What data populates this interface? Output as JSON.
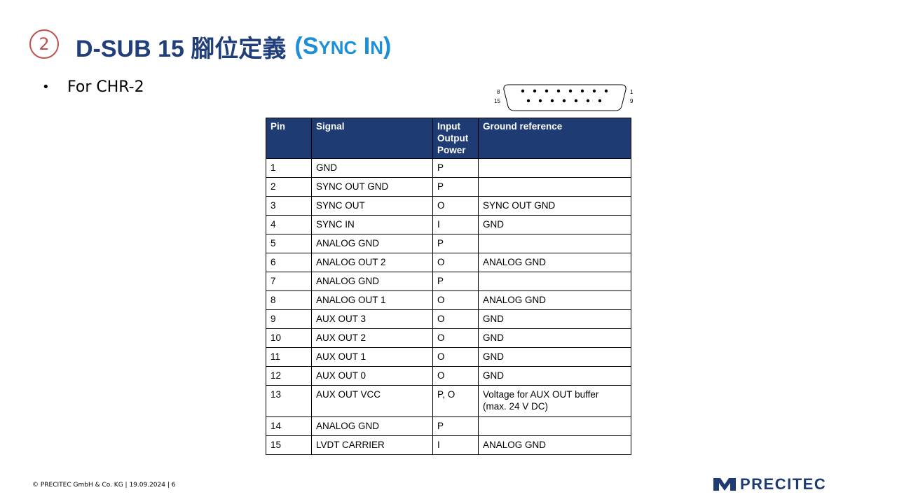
{
  "title": {
    "number": "2",
    "main": "D-SUB 15 腳位定義",
    "accent_open": "(",
    "accent_s": "S",
    "accent_ync": "YNC",
    "accent_i": "I",
    "accent_n": "N",
    "accent_close": ")"
  },
  "bullet": {
    "symbol": "•",
    "text": "For CHR-2"
  },
  "connector": {
    "label_8": "8",
    "label_15": "15",
    "label_1": "1",
    "label_9": "9"
  },
  "table": {
    "headers": {
      "pin": "Pin",
      "signal": "Signal",
      "io_line1": "Input",
      "io_line2": "Output",
      "io_line3": "Power",
      "ground": "Ground reference"
    },
    "rows": [
      {
        "pin": "1",
        "signal": "GND",
        "io": "P",
        "ground": ""
      },
      {
        "pin": "2",
        "signal": "SYNC OUT GND",
        "io": "P",
        "ground": ""
      },
      {
        "pin": "3",
        "signal": "SYNC OUT",
        "io": "O",
        "ground": "SYNC OUT GND"
      },
      {
        "pin": "4",
        "signal": "SYNC IN",
        "io": "I",
        "ground": "GND"
      },
      {
        "pin": "5",
        "signal": "ANALOG GND",
        "io": "P",
        "ground": ""
      },
      {
        "pin": "6",
        "signal": "ANALOG OUT 2",
        "io": "O",
        "ground": "ANALOG GND"
      },
      {
        "pin": "7",
        "signal": "ANALOG GND",
        "io": "P",
        "ground": ""
      },
      {
        "pin": "8",
        "signal": "ANALOG OUT 1",
        "io": "O",
        "ground": "ANALOG GND"
      },
      {
        "pin": "9",
        "signal": "AUX OUT 3",
        "io": "O",
        "ground": "GND"
      },
      {
        "pin": "10",
        "signal": "AUX OUT 2",
        "io": "O",
        "ground": "GND"
      },
      {
        "pin": "11",
        "signal": "AUX OUT 1",
        "io": "O",
        "ground": "GND"
      },
      {
        "pin": "12",
        "signal": "AUX OUT 0",
        "io": "O",
        "ground": "GND"
      },
      {
        "pin": "13",
        "signal": "AUX OUT VCC",
        "io": "P, O",
        "ground_line1": "Voltage for AUX OUT buffer",
        "ground_line2": "(max. 24 V DC)"
      },
      {
        "pin": "14",
        "signal": "ANALOG GND",
        "io": "P",
        "ground": ""
      },
      {
        "pin": "15",
        "signal": "LVDT CARRIER",
        "io": "I",
        "ground": "ANALOG GND"
      }
    ]
  },
  "footer": {
    "text": "© PRECITEC GmbH & Co. KG | 19.09.2024 | 6"
  },
  "logo": {
    "text": "PRECITEC",
    "icon": "precitec-logo-mark-icon"
  },
  "colors": {
    "title_blue": "#1f3e7a",
    "accent_blue": "#1b8fd8",
    "number_red": "#c0504d",
    "table_header_bg": "#1f3b74"
  }
}
